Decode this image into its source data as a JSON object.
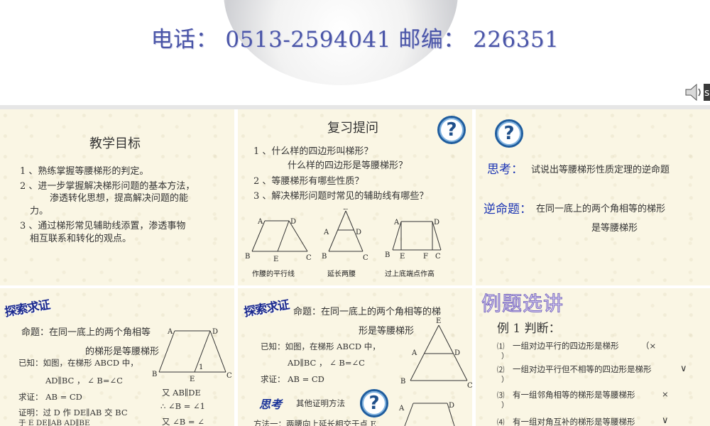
{
  "banner": {
    "contact": "电话： 0513-2594041  邮编： 226351"
  },
  "slide1": {
    "title": "教学目标",
    "item1": "1 、熟练掌握等腰梯形的判定。",
    "item2a": "2 、进一步掌握解决梯形问题的基本方法，",
    "item2b": "渗透转化思想，提高解决问题的能",
    "item2c": "力。",
    "item3a": "3 、通过梯形常见辅助线添置，渗透事物",
    "item3b": "相互联系和转化的观点。"
  },
  "slide2": {
    "title": "复习提问",
    "icon": "?",
    "q1a": "1 、什么样的四边形叫梯形？",
    "q1b": "什么样的四边形是等腰梯形？",
    "q2": "2 、等腰梯形有哪些性质？",
    "q3": "3 、解决梯形问题时常见的辅助线有哪些？",
    "fig1": {
      "A": "A",
      "D": "D",
      "B": "B",
      "E": "E",
      "C": "C",
      "caption": "作腰的平行线"
    },
    "fig2": {
      "E": "E",
      "A": "A",
      "D": "D",
      "B": "B",
      "C": "C",
      "caption": "延长两腰"
    },
    "fig3": {
      "A": "A",
      "D": "D",
      "B": "B",
      "E": "E",
      "F": "F",
      "C": "C",
      "caption": "过上底端点作高"
    }
  },
  "slide3": {
    "icon": "?",
    "think_label": "思考：",
    "think_text": "试说出等腰梯形性质定理的逆命题",
    "converse_label": "逆命题：",
    "converse_a": "在同一底上的两个角相等的梯形",
    "converse_b": "是等腰梯形"
  },
  "slide4": {
    "badge": "探索求证",
    "prop_a": "命题：在同一底上的两个角相等",
    "prop_b": "的梯形是等腰梯形",
    "given_a": "已知：如图，在梯形 ABCD 中，",
    "given_b": "AD∥BC ， ∠ B=∠C",
    "prove": "求证： AB = CD",
    "proof": "证明：过 D 作 DE∥AB 交 BC",
    "proof2": "于 E   DE∥AB    AD∥BE",
    "r1": "又  AB∥DE",
    "r2": "∴ ∠B = ∠1",
    "r3": "又  ∠B = ∠",
    "fig": {
      "A": "A",
      "D": "D",
      "B": "B",
      "E": "E",
      "C": "C",
      "one": "1"
    }
  },
  "slide5": {
    "badge": "探索求证",
    "prop_a": "命题：在同一底上的两个角相等的梯",
    "prop_b": "形是等腰梯形",
    "given_a": "已知：如图，在梯形 ABCD 中，",
    "given_b": "AD∥BC ， ∠ B=∠C",
    "prove": "求证： AB = CD",
    "think": "思考",
    "think_text": "其他证明方法",
    "icon": "?",
    "method": "方法一：两腰向上延长相交于点 E",
    "fig": {
      "E": "E",
      "A": "A",
      "D": "D",
      "B": "B",
      "C": "C"
    },
    "fig2": {
      "A": "A",
      "D": "D"
    }
  },
  "slide6": {
    "title": "例题选讲",
    "heading": "例 1  判断：",
    "items": [
      {
        "n": "⑴",
        "text": "一组对边平行的四边形是梯形",
        "mark": "（×",
        "close": "）"
      },
      {
        "n": "⑵",
        "text": "一组对边平行但不相等的四边形是梯形",
        "mark": "∨",
        "close": "）"
      },
      {
        "n": "⑶",
        "text": "有一组邻角相等的梯形是等腰梯形",
        "mark": "×",
        "close": "）"
      },
      {
        "n": "⑷",
        "text": "有一组对角互补的梯形是等腰梯形",
        "mark": "∨",
        "close": ""
      }
    ]
  }
}
